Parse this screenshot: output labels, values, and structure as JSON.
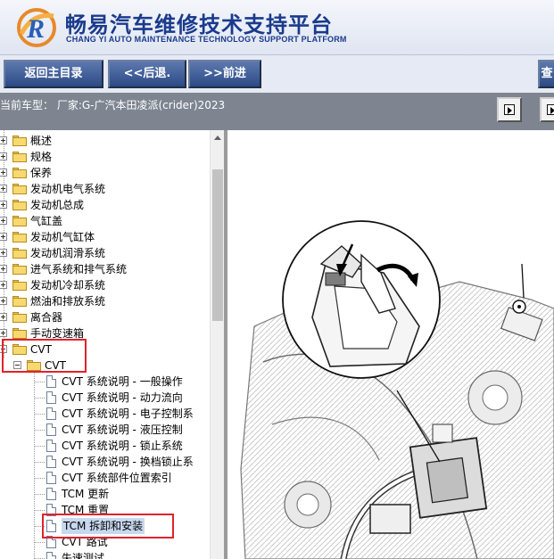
{
  "header": {
    "title": "畅易汽车维修技术支持平台",
    "subtitle": "CHANG YI AUTO MAINTENANCE TECHNOLOGY SUPPORT PLATFORM"
  },
  "toolbar": {
    "home_label": "返回主目录",
    "back_label": "<<后退.",
    "forward_label": ">>前进",
    "search_label": "查"
  },
  "model": {
    "text": "当前车型：  厂家:G-广汽本田凌派(crider)2023"
  },
  "tree": {
    "top_items": [
      "概述",
      "规格",
      "保养",
      "发动机电气系统",
      "发动机总成",
      "气缸盖",
      "发动机气缸体",
      "发动机润滑系统",
      "进气系统和排气系统",
      "发动机冷却系统",
      "燃油和排放系统",
      "离合器",
      "手动变速箱"
    ],
    "cvt_label": "CVT",
    "cvt_sub_label": "CVT",
    "docs": [
      "CVT 系统说明 - 一般操作",
      "CVT 系统说明 - 动力流向",
      "CVT 系统说明 - 电子控制系",
      "CVT 系统说明 - 液压控制",
      "CVT 系统说明 - 锁止系统",
      "CVT 系统说明 - 换档锁止系",
      "CVT 系统部件位置索引",
      "TCM 更新",
      "TCM 重置",
      "TCM 拆卸和安装",
      "CVT 路试",
      "失速测试"
    ],
    "selected_doc": "TCM 拆卸和安装"
  },
  "colors": {
    "brand_blue": "#1a3a8c",
    "button_blue": "#3b5a96",
    "highlight_red": "#e0232b"
  }
}
